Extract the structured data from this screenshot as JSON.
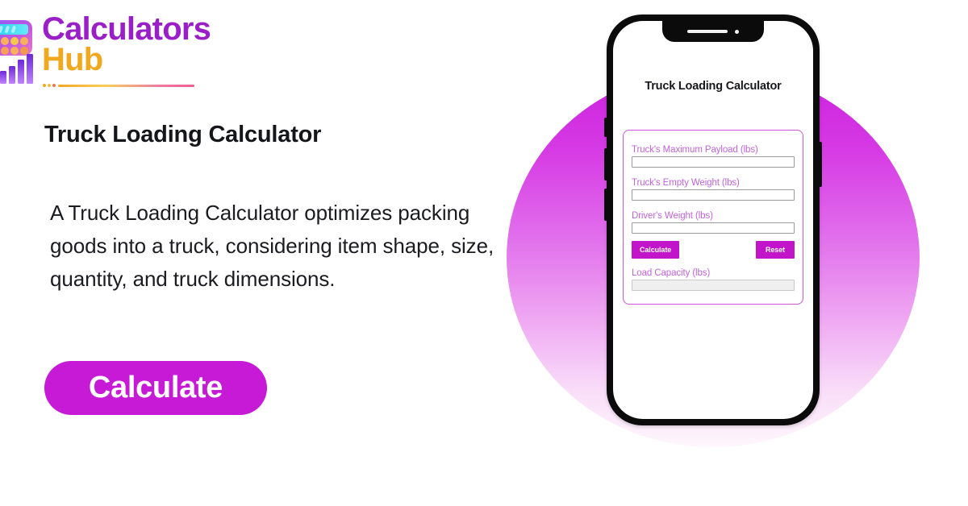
{
  "brand": {
    "name_line1": "Calculators",
    "name_line2": "Hub",
    "logo_icon": "calculator-bar-chart-icon",
    "colors": {
      "line1": "#9A1FC8",
      "line2": "#F0A81E",
      "accent": "#C61AD6"
    }
  },
  "left": {
    "headline": "Truck Loading Calculator",
    "body": "A Truck Loading Calculator optimizes packing goods into a truck, considering item shape, size, quantity, and truck dimensions.",
    "cta_label": "Calculate"
  },
  "phone": {
    "notch_speaker_icon": "speaker-grill-icon",
    "notch_camera_icon": "front-camera-icon",
    "side_buttons": [
      "silence-switch",
      "volume-up",
      "volume-down",
      "power"
    ],
    "app": {
      "title": "Truck Loading Calculator",
      "fields": [
        {
          "label": "Truck's Maximum Payload (lbs)",
          "value": "",
          "placeholder": "",
          "readonly": false
        },
        {
          "label": "Truck's Empty Weight (lbs)",
          "value": "",
          "placeholder": "",
          "readonly": false
        },
        {
          "label": "Driver's Weight (lbs)",
          "value": "",
          "placeholder": "",
          "readonly": false
        }
      ],
      "calculate_label": "Calculate",
      "reset_label": "Reset",
      "result": {
        "label": "Load Capacity (lbs)",
        "value": "",
        "placeholder": "",
        "readonly": true
      },
      "colors": {
        "label": "#C063DB",
        "button": "#C215C9",
        "card_border": "#CE56D6"
      }
    }
  },
  "background": {
    "circle_gradient_top": "#CB1FDE",
    "circle_gradient_bottom": "#FEF7FD"
  }
}
